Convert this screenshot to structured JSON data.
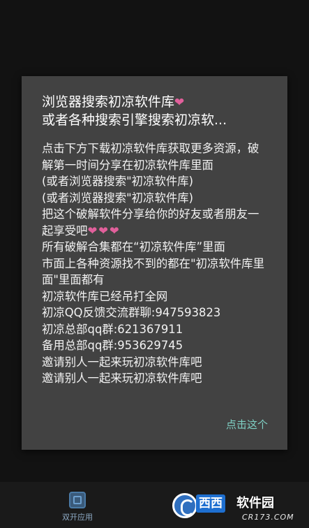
{
  "dialog": {
    "title_line1": "浏览器搜索初凉软件库",
    "title_heart": "❤",
    "title_line2": "或者各种搜索引擎搜索初凉软...",
    "body": [
      "点击下方下载初凉软件库获取更多资源，破解第一时间分享在初凉软件库里面",
      "(或者浏览器搜索\"初凉软件库)",
      "(或者浏览器搜索\"初凉软件库)",
      "把这个破解软件分享给你的好友或者朋友一起享受吧",
      "所有破解合集都在“初凉软件库”里面",
      "市面上各种资源找不到的都在\"初凉软件库里面\"里面都有",
      "初凉软件库已经吊打全网",
      "初凉QQ反馈交流群聊:947593823",
      "初凉总部qq群:621367911",
      "备用总部qq群:953629745",
      "邀请别人一起来玩初凉软件库吧",
      "邀请别人一起来玩初凉软件库吧"
    ],
    "hearts": "❤❤❤",
    "action_label": "点击这个"
  },
  "bottom_nav": {
    "item_label": "双开应用"
  },
  "watermark": {
    "badge": "西西",
    "name": "软件园",
    "site": "CR173.COM"
  }
}
